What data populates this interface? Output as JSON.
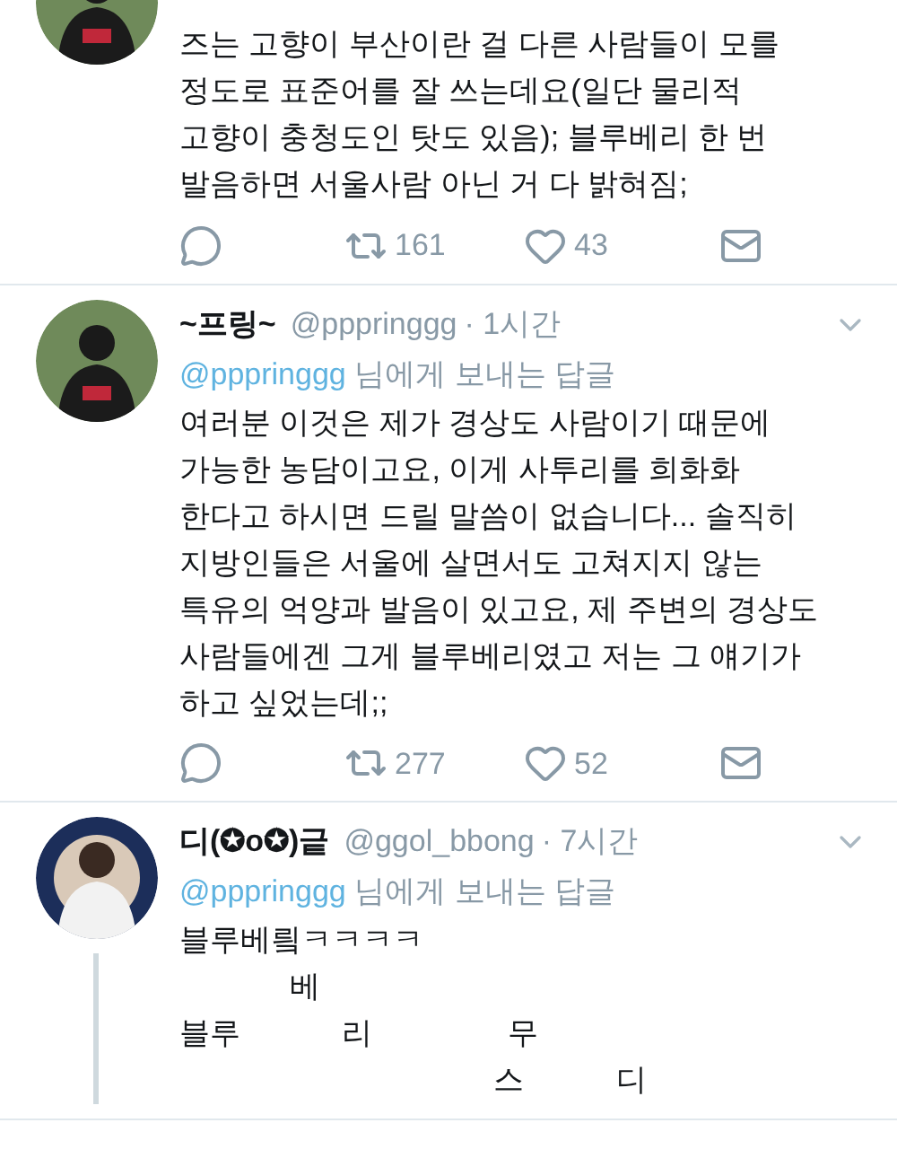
{
  "tweets": [
    {
      "body_lines": [
        "즈는 고향이 부산이란 걸 다른 사람들이 모를",
        "정도로 표준어를 잘 쓰는데요(일단 물리적",
        "고향이 충청도인 탓도 있음); 블루베리 한 번",
        "발음하면 서울사람 아닌 거 다 밝혀짐;"
      ],
      "retweets": "161",
      "likes": "43",
      "thread": false
    },
    {
      "name": "~프링~",
      "handle": "@pppringgg",
      "time": "· 1시간",
      "reply_to": "@pppringgg",
      "reply_suffix": "님에게 보내는 답글",
      "body_lines": [
        "여러분 이것은 제가 경상도 사람이기 때문에",
        "가능한 농담이고요, 이게 사투리를 희화화",
        "한다고 하시면 드릴 말씀이 없습니다... 솔직히",
        "지방인들은 서울에 살면서도 고쳐지지 않는",
        "특유의 억양과 발음이 있고요, 제 주변의 경상도",
        "사람들에겐 그게 블루베리였고 저는 그 얘기가",
        "하고 싶었는데;;"
      ],
      "retweets": "277",
      "likes": "52",
      "thread": false
    },
    {
      "name": "디(✪o✪)긑",
      "handle": "@ggol_bbong",
      "time": "· 7시간",
      "reply_to": "@pppringgg",
      "reply_suffix": "님에게 보내는 답글",
      "body_lines": [
        "블루베릨ㅋㅋㅋㅋ",
        "             베",
        "블루            리                무",
        "                                     스           디"
      ],
      "thread": true
    }
  ]
}
